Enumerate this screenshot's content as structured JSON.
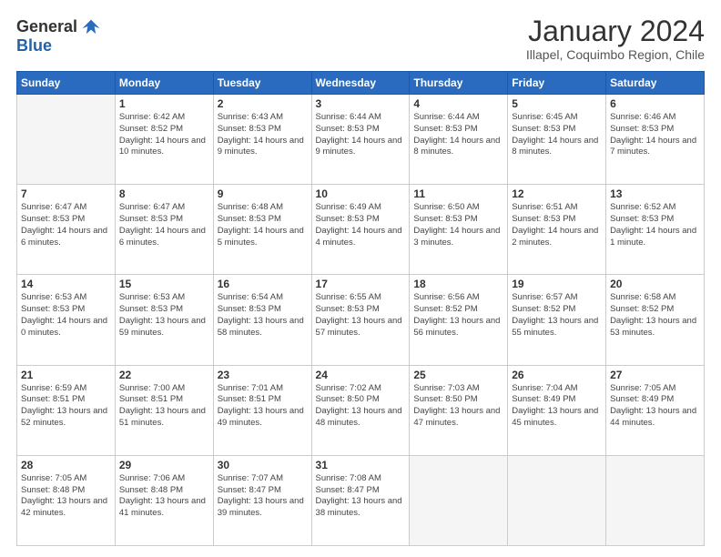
{
  "header": {
    "logo_general": "General",
    "logo_blue": "Blue",
    "month_title": "January 2024",
    "location": "Illapel, Coquimbo Region, Chile"
  },
  "weekdays": [
    "Sunday",
    "Monday",
    "Tuesday",
    "Wednesday",
    "Thursday",
    "Friday",
    "Saturday"
  ],
  "weeks": [
    [
      {
        "day": "",
        "empty": true
      },
      {
        "day": "1",
        "sunrise": "6:42 AM",
        "sunset": "8:52 PM",
        "daylight": "14 hours and 10 minutes."
      },
      {
        "day": "2",
        "sunrise": "6:43 AM",
        "sunset": "8:53 PM",
        "daylight": "14 hours and 9 minutes."
      },
      {
        "day": "3",
        "sunrise": "6:44 AM",
        "sunset": "8:53 PM",
        "daylight": "14 hours and 9 minutes."
      },
      {
        "day": "4",
        "sunrise": "6:44 AM",
        "sunset": "8:53 PM",
        "daylight": "14 hours and 8 minutes."
      },
      {
        "day": "5",
        "sunrise": "6:45 AM",
        "sunset": "8:53 PM",
        "daylight": "14 hours and 8 minutes."
      },
      {
        "day": "6",
        "sunrise": "6:46 AM",
        "sunset": "8:53 PM",
        "daylight": "14 hours and 7 minutes."
      }
    ],
    [
      {
        "day": "7",
        "sunrise": "6:47 AM",
        "sunset": "8:53 PM",
        "daylight": "14 hours and 6 minutes."
      },
      {
        "day": "8",
        "sunrise": "6:47 AM",
        "sunset": "8:53 PM",
        "daylight": "14 hours and 6 minutes."
      },
      {
        "day": "9",
        "sunrise": "6:48 AM",
        "sunset": "8:53 PM",
        "daylight": "14 hours and 5 minutes."
      },
      {
        "day": "10",
        "sunrise": "6:49 AM",
        "sunset": "8:53 PM",
        "daylight": "14 hours and 4 minutes."
      },
      {
        "day": "11",
        "sunrise": "6:50 AM",
        "sunset": "8:53 PM",
        "daylight": "14 hours and 3 minutes."
      },
      {
        "day": "12",
        "sunrise": "6:51 AM",
        "sunset": "8:53 PM",
        "daylight": "14 hours and 2 minutes."
      },
      {
        "day": "13",
        "sunrise": "6:52 AM",
        "sunset": "8:53 PM",
        "daylight": "14 hours and 1 minute."
      }
    ],
    [
      {
        "day": "14",
        "sunrise": "6:53 AM",
        "sunset": "8:53 PM",
        "daylight": "14 hours and 0 minutes."
      },
      {
        "day": "15",
        "sunrise": "6:53 AM",
        "sunset": "8:53 PM",
        "daylight": "13 hours and 59 minutes."
      },
      {
        "day": "16",
        "sunrise": "6:54 AM",
        "sunset": "8:53 PM",
        "daylight": "13 hours and 58 minutes."
      },
      {
        "day": "17",
        "sunrise": "6:55 AM",
        "sunset": "8:53 PM",
        "daylight": "13 hours and 57 minutes."
      },
      {
        "day": "18",
        "sunrise": "6:56 AM",
        "sunset": "8:52 PM",
        "daylight": "13 hours and 56 minutes."
      },
      {
        "day": "19",
        "sunrise": "6:57 AM",
        "sunset": "8:52 PM",
        "daylight": "13 hours and 55 minutes."
      },
      {
        "day": "20",
        "sunrise": "6:58 AM",
        "sunset": "8:52 PM",
        "daylight": "13 hours and 53 minutes."
      }
    ],
    [
      {
        "day": "21",
        "sunrise": "6:59 AM",
        "sunset": "8:51 PM",
        "daylight": "13 hours and 52 minutes."
      },
      {
        "day": "22",
        "sunrise": "7:00 AM",
        "sunset": "8:51 PM",
        "daylight": "13 hours and 51 minutes."
      },
      {
        "day": "23",
        "sunrise": "7:01 AM",
        "sunset": "8:51 PM",
        "daylight": "13 hours and 49 minutes."
      },
      {
        "day": "24",
        "sunrise": "7:02 AM",
        "sunset": "8:50 PM",
        "daylight": "13 hours and 48 minutes."
      },
      {
        "day": "25",
        "sunrise": "7:03 AM",
        "sunset": "8:50 PM",
        "daylight": "13 hours and 47 minutes."
      },
      {
        "day": "26",
        "sunrise": "7:04 AM",
        "sunset": "8:49 PM",
        "daylight": "13 hours and 45 minutes."
      },
      {
        "day": "27",
        "sunrise": "7:05 AM",
        "sunset": "8:49 PM",
        "daylight": "13 hours and 44 minutes."
      }
    ],
    [
      {
        "day": "28",
        "sunrise": "7:05 AM",
        "sunset": "8:48 PM",
        "daylight": "13 hours and 42 minutes."
      },
      {
        "day": "29",
        "sunrise": "7:06 AM",
        "sunset": "8:48 PM",
        "daylight": "13 hours and 41 minutes."
      },
      {
        "day": "30",
        "sunrise": "7:07 AM",
        "sunset": "8:47 PM",
        "daylight": "13 hours and 39 minutes."
      },
      {
        "day": "31",
        "sunrise": "7:08 AM",
        "sunset": "8:47 PM",
        "daylight": "13 hours and 38 minutes."
      },
      {
        "day": "",
        "empty": true
      },
      {
        "day": "",
        "empty": true
      },
      {
        "day": "",
        "empty": true
      }
    ]
  ]
}
